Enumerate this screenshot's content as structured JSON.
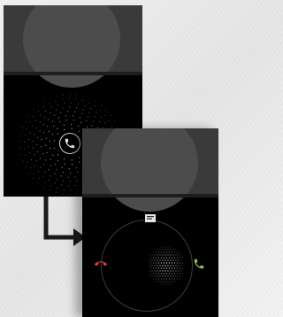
{
  "screens": [
    {
      "state": "locked",
      "handle_icon": "phone-icon",
      "colors": {
        "background": "#000000",
        "top_band": "#3a3a3a",
        "handle_ring": "#d0d0d0"
      }
    },
    {
      "state": "unlocking",
      "targets": [
        {
          "icon": "message-icon",
          "position": "top",
          "color": "#e6e6e6"
        },
        {
          "icon": "decline-call-icon",
          "position": "left",
          "color": "#e03a3a"
        },
        {
          "icon": "answer-call-icon",
          "position": "right",
          "color": "#8cc63f"
        }
      ],
      "colors": {
        "background": "#000000",
        "ring": "#3c3c3c"
      }
    }
  ],
  "connector_icon": "flow-arrow-icon"
}
